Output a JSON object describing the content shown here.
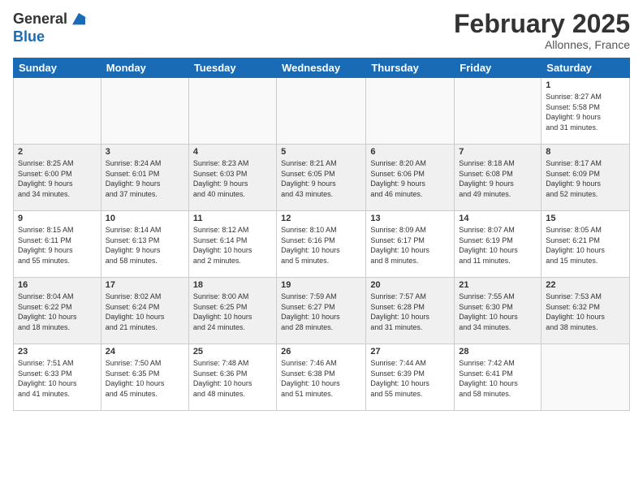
{
  "header": {
    "logo_general": "General",
    "logo_blue": "Blue",
    "month_title": "February 2025",
    "location": "Allonnes, France"
  },
  "weekdays": [
    "Sunday",
    "Monday",
    "Tuesday",
    "Wednesday",
    "Thursday",
    "Friday",
    "Saturday"
  ],
  "weeks": [
    {
      "shaded": false,
      "days": [
        {
          "num": "",
          "info": ""
        },
        {
          "num": "",
          "info": ""
        },
        {
          "num": "",
          "info": ""
        },
        {
          "num": "",
          "info": ""
        },
        {
          "num": "",
          "info": ""
        },
        {
          "num": "",
          "info": ""
        },
        {
          "num": "1",
          "info": "Sunrise: 8:27 AM\nSunset: 5:58 PM\nDaylight: 9 hours\nand 31 minutes."
        }
      ]
    },
    {
      "shaded": true,
      "days": [
        {
          "num": "2",
          "info": "Sunrise: 8:25 AM\nSunset: 6:00 PM\nDaylight: 9 hours\nand 34 minutes."
        },
        {
          "num": "3",
          "info": "Sunrise: 8:24 AM\nSunset: 6:01 PM\nDaylight: 9 hours\nand 37 minutes."
        },
        {
          "num": "4",
          "info": "Sunrise: 8:23 AM\nSunset: 6:03 PM\nDaylight: 9 hours\nand 40 minutes."
        },
        {
          "num": "5",
          "info": "Sunrise: 8:21 AM\nSunset: 6:05 PM\nDaylight: 9 hours\nand 43 minutes."
        },
        {
          "num": "6",
          "info": "Sunrise: 8:20 AM\nSunset: 6:06 PM\nDaylight: 9 hours\nand 46 minutes."
        },
        {
          "num": "7",
          "info": "Sunrise: 8:18 AM\nSunset: 6:08 PM\nDaylight: 9 hours\nand 49 minutes."
        },
        {
          "num": "8",
          "info": "Sunrise: 8:17 AM\nSunset: 6:09 PM\nDaylight: 9 hours\nand 52 minutes."
        }
      ]
    },
    {
      "shaded": false,
      "days": [
        {
          "num": "9",
          "info": "Sunrise: 8:15 AM\nSunset: 6:11 PM\nDaylight: 9 hours\nand 55 minutes."
        },
        {
          "num": "10",
          "info": "Sunrise: 8:14 AM\nSunset: 6:13 PM\nDaylight: 9 hours\nand 58 minutes."
        },
        {
          "num": "11",
          "info": "Sunrise: 8:12 AM\nSunset: 6:14 PM\nDaylight: 10 hours\nand 2 minutes."
        },
        {
          "num": "12",
          "info": "Sunrise: 8:10 AM\nSunset: 6:16 PM\nDaylight: 10 hours\nand 5 minutes."
        },
        {
          "num": "13",
          "info": "Sunrise: 8:09 AM\nSunset: 6:17 PM\nDaylight: 10 hours\nand 8 minutes."
        },
        {
          "num": "14",
          "info": "Sunrise: 8:07 AM\nSunset: 6:19 PM\nDaylight: 10 hours\nand 11 minutes."
        },
        {
          "num": "15",
          "info": "Sunrise: 8:05 AM\nSunset: 6:21 PM\nDaylight: 10 hours\nand 15 minutes."
        }
      ]
    },
    {
      "shaded": true,
      "days": [
        {
          "num": "16",
          "info": "Sunrise: 8:04 AM\nSunset: 6:22 PM\nDaylight: 10 hours\nand 18 minutes."
        },
        {
          "num": "17",
          "info": "Sunrise: 8:02 AM\nSunset: 6:24 PM\nDaylight: 10 hours\nand 21 minutes."
        },
        {
          "num": "18",
          "info": "Sunrise: 8:00 AM\nSunset: 6:25 PM\nDaylight: 10 hours\nand 24 minutes."
        },
        {
          "num": "19",
          "info": "Sunrise: 7:59 AM\nSunset: 6:27 PM\nDaylight: 10 hours\nand 28 minutes."
        },
        {
          "num": "20",
          "info": "Sunrise: 7:57 AM\nSunset: 6:28 PM\nDaylight: 10 hours\nand 31 minutes."
        },
        {
          "num": "21",
          "info": "Sunrise: 7:55 AM\nSunset: 6:30 PM\nDaylight: 10 hours\nand 34 minutes."
        },
        {
          "num": "22",
          "info": "Sunrise: 7:53 AM\nSunset: 6:32 PM\nDaylight: 10 hours\nand 38 minutes."
        }
      ]
    },
    {
      "shaded": false,
      "days": [
        {
          "num": "23",
          "info": "Sunrise: 7:51 AM\nSunset: 6:33 PM\nDaylight: 10 hours\nand 41 minutes."
        },
        {
          "num": "24",
          "info": "Sunrise: 7:50 AM\nSunset: 6:35 PM\nDaylight: 10 hours\nand 45 minutes."
        },
        {
          "num": "25",
          "info": "Sunrise: 7:48 AM\nSunset: 6:36 PM\nDaylight: 10 hours\nand 48 minutes."
        },
        {
          "num": "26",
          "info": "Sunrise: 7:46 AM\nSunset: 6:38 PM\nDaylight: 10 hours\nand 51 minutes."
        },
        {
          "num": "27",
          "info": "Sunrise: 7:44 AM\nSunset: 6:39 PM\nDaylight: 10 hours\nand 55 minutes."
        },
        {
          "num": "28",
          "info": "Sunrise: 7:42 AM\nSunset: 6:41 PM\nDaylight: 10 hours\nand 58 minutes."
        },
        {
          "num": "",
          "info": ""
        }
      ]
    }
  ]
}
